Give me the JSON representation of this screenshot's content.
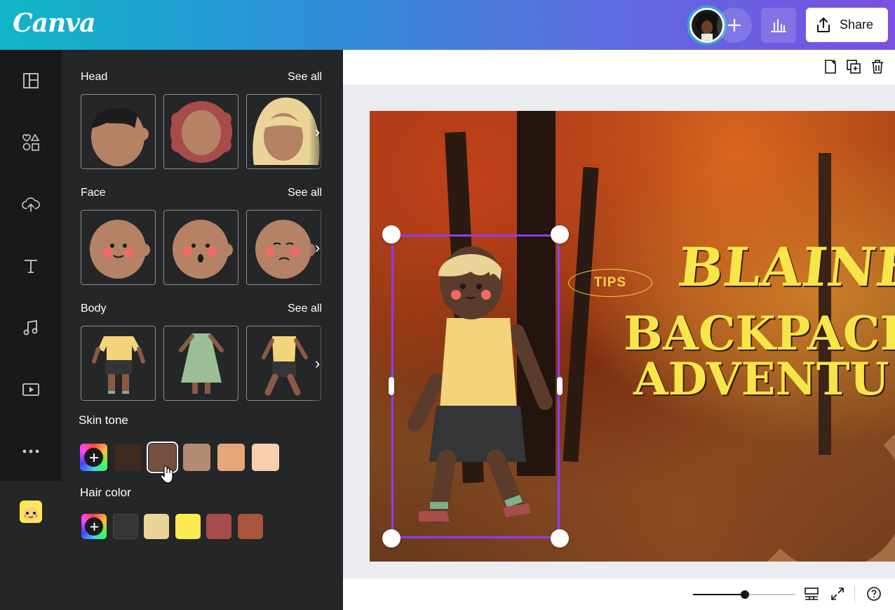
{
  "app": {
    "logo": "Canva"
  },
  "topbar": {
    "share_label": "Share"
  },
  "sections": [
    {
      "title": "Head",
      "see_all": "See all"
    },
    {
      "title": "Face",
      "see_all": "See all"
    },
    {
      "title": "Body",
      "see_all": "See all"
    }
  ],
  "skin_tone": {
    "title": "Skin tone",
    "colors": [
      "#3f2a1f",
      "#73503f",
      "#b38a72",
      "#e5a77a",
      "#f7cfad"
    ],
    "selected_index": 1
  },
  "hair_color": {
    "title": "Hair color",
    "colors": [
      "#343536",
      "#ead497",
      "#fbe94f",
      "#a74c4b",
      "#a8553a"
    ]
  },
  "design": {
    "tips": "TIPS",
    "line1": "BLAINE",
    "line2": "BACKPACK",
    "line3": "ADVENTU"
  }
}
